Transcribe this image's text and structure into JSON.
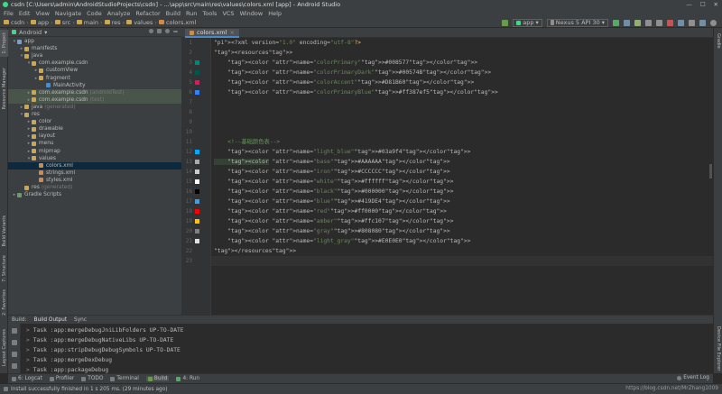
{
  "window": {
    "title": "csdn [C:\\Users\\admin\\AndroidStudioProjects\\csdn] - ...\\app\\src\\main\\res\\values\\colors.xml [app] - Android Studio",
    "controls": [
      "—",
      "☐",
      "✕"
    ]
  },
  "menu": [
    "File",
    "Edit",
    "View",
    "Navigate",
    "Code",
    "Analyze",
    "Refactor",
    "Build",
    "Run",
    "Tools",
    "VCS",
    "Window",
    "Help"
  ],
  "breadcrumbs": [
    "csdn",
    "app",
    "src",
    "main",
    "res",
    "values",
    "colors.xml"
  ],
  "toolbar": {
    "run_config": "app",
    "device": "Nexus 5 API 30"
  },
  "project": {
    "view_mode": "Android",
    "tree": [
      {
        "label": "app",
        "extra": "",
        "depth": 0,
        "arrow": "▾",
        "icon": "#7aa0c8",
        "hl": ""
      },
      {
        "label": "manifests",
        "extra": "",
        "depth": 1,
        "arrow": "▸",
        "icon": "#c9a755",
        "hl": ""
      },
      {
        "label": "java",
        "extra": "",
        "depth": 1,
        "arrow": "▾",
        "icon": "#c9a755",
        "hl": ""
      },
      {
        "label": "com.example.csdn",
        "extra": "",
        "depth": 2,
        "arrow": "▾",
        "icon": "#c9a755",
        "hl": ""
      },
      {
        "label": "customView",
        "extra": "",
        "depth": 3,
        "arrow": "▸",
        "icon": "#c9a755",
        "hl": ""
      },
      {
        "label": "fragment",
        "extra": "",
        "depth": 3,
        "arrow": "▸",
        "icon": "#c9a755",
        "hl": ""
      },
      {
        "label": "MainActivity",
        "extra": "",
        "depth": 4,
        "arrow": "",
        "icon": "#3d8fd6",
        "hl": ""
      },
      {
        "label": "com.example.csdn",
        "extra": "(androidTest)",
        "depth": 2,
        "arrow": "▸",
        "icon": "#c9a755",
        "hl": "green"
      },
      {
        "label": "com.example.csdn",
        "extra": "(test)",
        "depth": 2,
        "arrow": "▸",
        "icon": "#c9a755",
        "hl": "green"
      },
      {
        "label": "java",
        "extra": "(generated)",
        "depth": 1,
        "arrow": "▸",
        "icon": "#c9a755",
        "hl": ""
      },
      {
        "label": "res",
        "extra": "",
        "depth": 1,
        "arrow": "▾",
        "icon": "#c9a755",
        "hl": ""
      },
      {
        "label": "color",
        "extra": "",
        "depth": 2,
        "arrow": "▸",
        "icon": "#c9a755",
        "hl": ""
      },
      {
        "label": "drawable",
        "extra": "",
        "depth": 2,
        "arrow": "▸",
        "icon": "#c9a755",
        "hl": ""
      },
      {
        "label": "layout",
        "extra": "",
        "depth": 2,
        "arrow": "▸",
        "icon": "#c9a755",
        "hl": ""
      },
      {
        "label": "menu",
        "extra": "",
        "depth": 2,
        "arrow": "▸",
        "icon": "#c9a755",
        "hl": ""
      },
      {
        "label": "mipmap",
        "extra": "",
        "depth": 2,
        "arrow": "▸",
        "icon": "#c9a755",
        "hl": ""
      },
      {
        "label": "values",
        "extra": "",
        "depth": 2,
        "arrow": "▾",
        "icon": "#c9a755",
        "hl": ""
      },
      {
        "label": "colors.xml",
        "extra": "",
        "depth": 3,
        "arrow": "",
        "icon": "#d08a4b",
        "hl": "sel"
      },
      {
        "label": "strings.xml",
        "extra": "",
        "depth": 3,
        "arrow": "",
        "icon": "#d08a4b",
        "hl": ""
      },
      {
        "label": "styles.xml",
        "extra": "",
        "depth": 3,
        "arrow": "",
        "icon": "#d08a4b",
        "hl": ""
      },
      {
        "label": "res",
        "extra": "(generated)",
        "depth": 1,
        "arrow": "",
        "icon": "#c9a755",
        "hl": ""
      },
      {
        "label": "Gradle Scripts",
        "extra": "",
        "depth": 0,
        "arrow": "▸",
        "icon": "#6f9a6f",
        "hl": ""
      }
    ]
  },
  "side_tabs": {
    "left": [
      "1: Project",
      "Resource Manager",
      "Build Variants",
      "7: Structure",
      "2: Favorites",
      "Layout Captures"
    ],
    "right": [
      "Gradle",
      "Device File Explorer"
    ]
  },
  "editor": {
    "tab": "colors.xml",
    "lines": [
      {
        "n": 1,
        "swatch": "",
        "text": "<?xml version=\"1.0\" encoding=\"utf-8\"?>"
      },
      {
        "n": 2,
        "swatch": "",
        "text": "<resources>"
      },
      {
        "n": 3,
        "swatch": "#008577",
        "text": "    <color name=\"colorPrimary\">#008577</color>"
      },
      {
        "n": 4,
        "swatch": "#00574B",
        "text": "    <color name=\"colorPrimaryDark\">#00574B</color>"
      },
      {
        "n": 5,
        "swatch": "#D81B60",
        "text": "    <color name=\"colorAccent\">#D81B60</color>"
      },
      {
        "n": 6,
        "swatch": "#387ef5",
        "text": "    <color name=\"colorPrimaryBlue\">#ff387ef5</color>"
      },
      {
        "n": 7,
        "swatch": "",
        "text": ""
      },
      {
        "n": 8,
        "swatch": "",
        "text": ""
      },
      {
        "n": 9,
        "swatch": "",
        "text": ""
      },
      {
        "n": 10,
        "swatch": "",
        "text": ""
      },
      {
        "n": 11,
        "swatch": "",
        "text": "    <!--基础颜色表-->"
      },
      {
        "n": 12,
        "swatch": "#03a9f4",
        "text": "    <color name=\"light_blue\">#03a9f4</color>"
      },
      {
        "n": 13,
        "swatch": "#AAAAAA",
        "text": "    <color name=\"base\">#AAAAAA</color>"
      },
      {
        "n": 14,
        "swatch": "#CCCCCC",
        "text": "    <color name=\"iron\">#CCCCCC</color>"
      },
      {
        "n": 15,
        "swatch": "#ffffff",
        "text": "    <color name=\"white\">#ffffff</color>"
      },
      {
        "n": 16,
        "swatch": "#000000",
        "text": "    <color name=\"black\">#000000</color>"
      },
      {
        "n": 17,
        "swatch": "#419DE4",
        "text": "    <color name=\"blue\">#419DE4</color>"
      },
      {
        "n": 18,
        "swatch": "#ff0000",
        "text": "    <color name=\"red\">#ff0000</color>"
      },
      {
        "n": 19,
        "swatch": "#ffc107",
        "text": "    <color name=\"amber\">#ffc107</color>"
      },
      {
        "n": 20,
        "swatch": "#808080",
        "text": "    <color name=\"gray\">#808080</color>"
      },
      {
        "n": 21,
        "swatch": "#E0E0E0",
        "text": "    <color name=\"light_gray\">#E0E0E0</color>"
      },
      {
        "n": 22,
        "swatch": "",
        "text": "</resources>"
      },
      {
        "n": 23,
        "swatch": "",
        "text": ""
      }
    ]
  },
  "build": {
    "tabs": [
      "Build:",
      "Build Output",
      "Sync"
    ],
    "lines": [
      "Task :app:mergeDebugJniLibFolders UP-TO-DATE",
      "Task :app:mergeDebugNativeLibs UP-TO-DATE",
      "Task :app:stripDebugDebugSymbols UP-TO-DATE",
      "Task :app:mergeDexDebug",
      "Task :app:packageDebug"
    ]
  },
  "bottom_tabs": [
    "6: Logcat",
    "Profiler",
    "TODO",
    "Terminal",
    "Build",
    "4: Run"
  ],
  "event_log": "Event Log",
  "status": {
    "message": "Install successfully finished in 1 s 205 ms. (29 minutes ago)",
    "watermark": "https://blog.csdn.net/MrZhang1009"
  }
}
